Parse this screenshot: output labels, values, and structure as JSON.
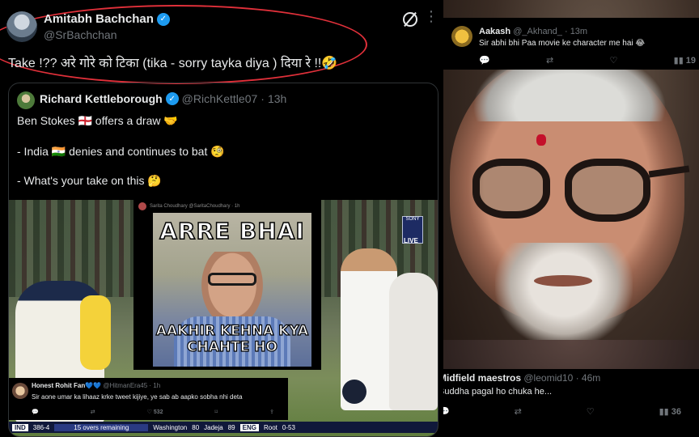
{
  "main_tweet": {
    "name": "Amitabh Bachchan",
    "handle": "@SrBachchan",
    "text": "Take  !?? अरे गोरे को टिका (tika - sorry tayka diya ) दिया रे  !!🤣",
    "grok_icon": "grok-icon",
    "more_icon": "more-icon"
  },
  "quoted_tweet": {
    "name": "Richard Kettleborough",
    "handle": "@RichKettle07",
    "time": "13h",
    "lines": [
      "Ben Stokes 🏴󠁧󠁢󠁥󠁮󠁧󠁿 offers a draw 🤝",
      "- India 🇮🇳 denies and continues to bat 🧐",
      "- What's your take on this 🤔"
    ]
  },
  "meme": {
    "header": "Sarita Choudhary  @SaritaChoudhary · 1h",
    "top_text": "ARRE BHAI",
    "bottom_text_1": "AAKHIR KEHNA KYA",
    "bottom_text_2": "CHAHTE HO"
  },
  "broadcast": {
    "logo": "SONY",
    "live": "LIVE"
  },
  "reply_overlay": {
    "name": "Honest Rohit Fan💙💙",
    "handle": "@HitmanEra45 · 1h",
    "text": "Sir aone umar ka lihaaz krke tweet kijiye, ye sab ab aapko sobha nhi deta",
    "likes": "532"
  },
  "scorebar": {
    "team1": "IND",
    "score": "386-4",
    "overs": "15 overs remaining",
    "batter1": "Washington",
    "batter1_runs": "80",
    "batter2": "Jadeja",
    "batter2_runs": "89",
    "team2": "ENG",
    "bowler": "Root",
    "bowler_fig": "0-53"
  },
  "reply_aakash": {
    "name": "Aakash",
    "handle": "@_Akhand_ · 13m",
    "text": "Sir abhi bhi Paa movie ke character me hai 😂",
    "views": "19"
  },
  "reply_midfield": {
    "name": "Midfield maestros",
    "handle": "@leomid10 · 46m",
    "text": "Buddha pagal ho chuka he...",
    "views": "36"
  },
  "icons": {
    "reply": "reply-icon",
    "retweet": "retweet-icon",
    "like": "like-icon",
    "views": "views-icon",
    "verified": "verified-icon"
  },
  "colors": {
    "highlight": "#e0303a",
    "verified": "#1d9bf0",
    "muted": "#71767b"
  }
}
